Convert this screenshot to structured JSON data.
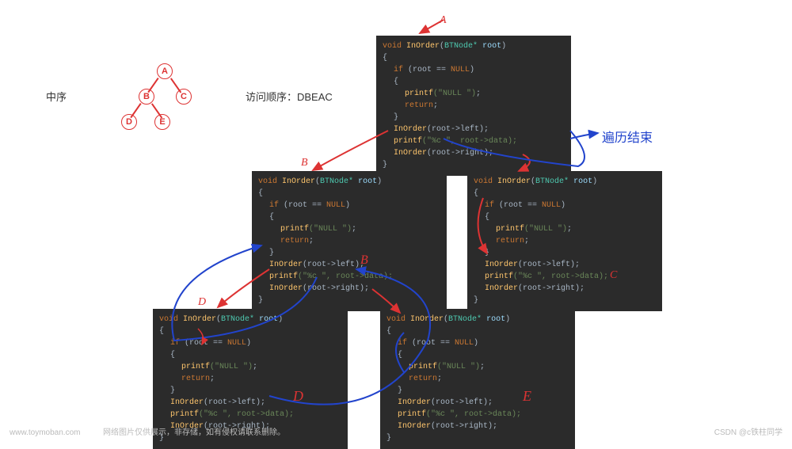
{
  "labels": {
    "inorder": "中序",
    "visit_order": "访问顺序：DBEAC"
  },
  "tree": {
    "nodes": [
      "A",
      "B",
      "C",
      "D",
      "E"
    ]
  },
  "code": {
    "line1_void": "void",
    "line1_fn": " InOrder",
    "line1_type": "BTNode*",
    "line1_param": " root",
    "lbrace": "{",
    "if_kw": "if",
    "if_cond": " (root == ",
    "null": "NULL",
    "if_close": ")",
    "lbrace2": "{",
    "printf": "printf",
    "null_str": "(\"NULL \")",
    "semi": ";",
    "return": "return",
    "rbrace2": "}",
    "call_left": "(root->left);",
    "printf_data": "(\"%c \", root->data);",
    "call_right": "(root->right);",
    "rbrace": "}"
  },
  "annotations": {
    "A": "A",
    "B": "B",
    "C": "C",
    "D": "D",
    "E": "E",
    "end_traverse": "遍历结束"
  },
  "footer": {
    "domain": "www.toymoban.com",
    "disclaimer": "网络图片仅供展示，非存储，如有侵权请联系删除。",
    "credit": "CSDN @c铁柱同学"
  }
}
